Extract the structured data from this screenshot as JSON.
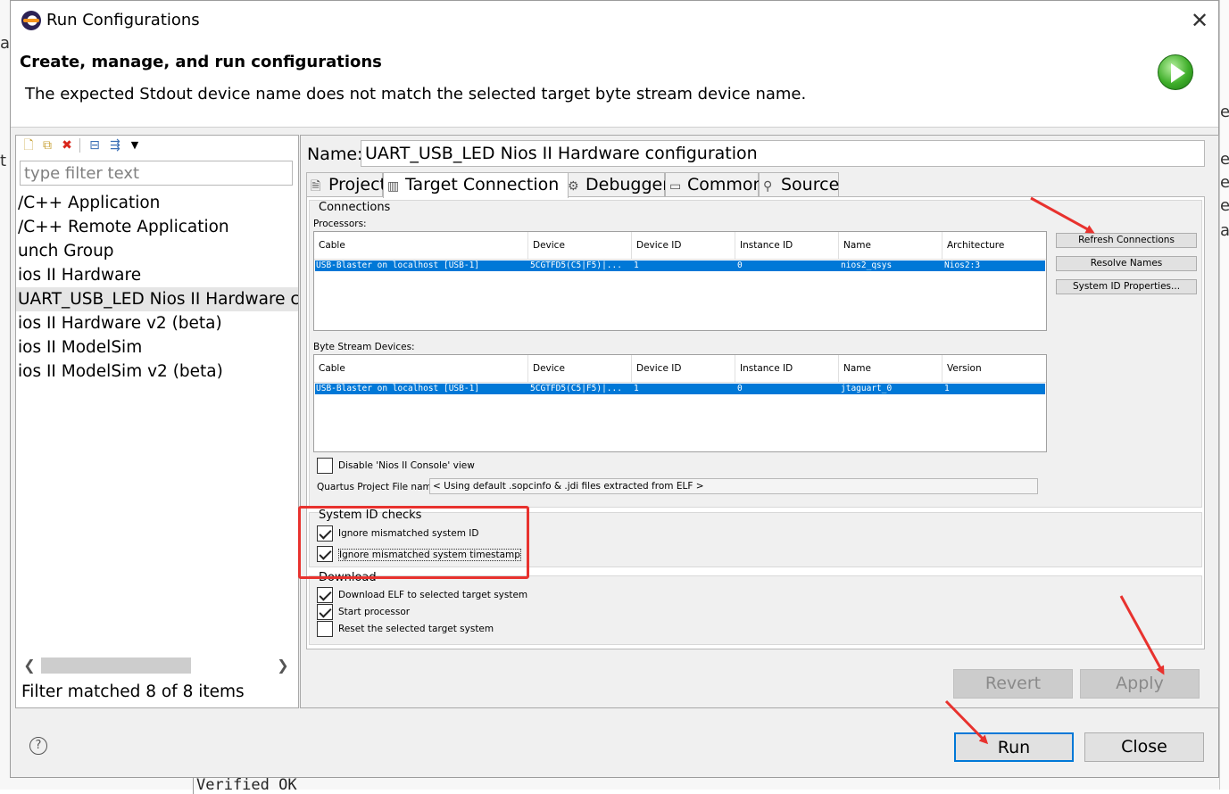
{
  "window": {
    "title": "Run Configurations",
    "close_glyph": "✕"
  },
  "header": {
    "title": "Create, manage, and run configurations",
    "message": "The expected Stdout device name does not match the selected target byte stream device name."
  },
  "left_panel": {
    "filter_placeholder": "type filter text",
    "items": [
      "/C++ Application",
      "/C++ Remote Application",
      "unch Group",
      "ios II Hardware",
      "UART_USB_LED Nios II Hardware co",
      "ios II Hardware v2 (beta)",
      "ios II ModelSim",
      "ios II ModelSim v2 (beta)"
    ],
    "selected_index": 4,
    "status": "Filter matched 8 of 8 items"
  },
  "config": {
    "name_label": "Name:",
    "name_value": "UART_USB_LED Nios II Hardware configuration",
    "tabs": [
      "Project",
      "Target Connection",
      "Debugger",
      "Common",
      "Source"
    ],
    "active_tab": "Target Connection",
    "connections": {
      "title": "Connections",
      "processors_label": "Processors:",
      "processors_columns": [
        "Cable",
        "Device",
        "Device ID",
        "Instance ID",
        "Name",
        "Architecture"
      ],
      "processors_row": [
        "USB-Blaster on localhost [USB-1]",
        "5CGTFD5(C5|F5)|...",
        "1",
        "0",
        "nios2_qsys",
        "Nios2:3"
      ],
      "byte_stream_label": "Byte Stream Devices:",
      "byte_stream_columns": [
        "Cable",
        "Device",
        "Device ID",
        "Instance ID",
        "Name",
        "Version"
      ],
      "byte_stream_row": [
        "USB-Blaster on localhost [USB-1]",
        "5CGTFD5(C5|F5)|...",
        "1",
        "0",
        "jtaguart_0",
        "1"
      ],
      "refresh_label": "Refresh Connections",
      "resolve_label": "Resolve Names",
      "sysid_props_label": "System ID Properties...",
      "disable_console_label": "Disable 'Nios II Console' view",
      "quartus_label": "Quartus Project File name:",
      "quartus_value": "< Using default .sopcinfo & .jdi files extracted from ELF >"
    },
    "system_id": {
      "title": "System ID checks",
      "ignore_id_label": "Ignore mismatched system ID",
      "ignore_timestamp_label": "Ignore mismatched system timestamp"
    },
    "download": {
      "title": "Download",
      "download_elf_label": "Download ELF to selected target system",
      "start_processor_label": "Start processor",
      "reset_label": "Reset the selected target system"
    }
  },
  "buttons": {
    "revert": "Revert",
    "apply": "Apply",
    "run": "Run",
    "close": "Close",
    "help": "?"
  },
  "background": {
    "bottom_text": "Verified OK"
  },
  "colors": {
    "selection": "#0078d7",
    "annotation": "#e8322e",
    "default_button_border": "#0078d7"
  }
}
